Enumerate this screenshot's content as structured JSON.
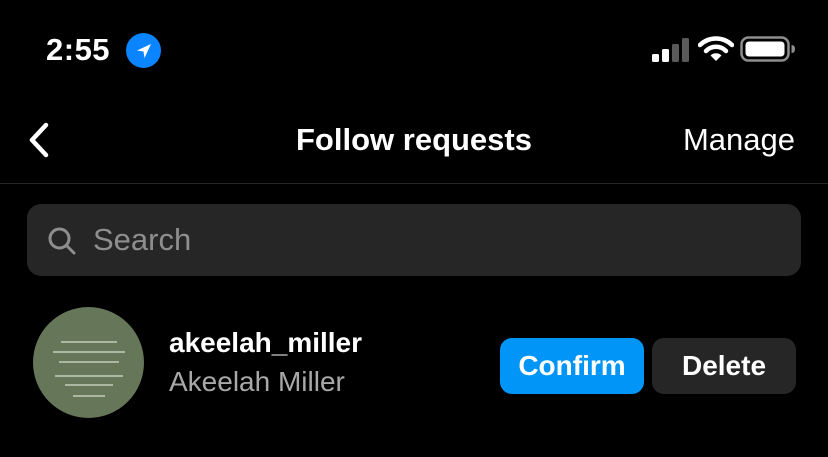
{
  "status_bar": {
    "time": "2:55",
    "location_icon": "location-arrow-icon",
    "signal_icon": "cellular-signal-icon",
    "wifi_icon": "wifi-icon",
    "battery_icon": "battery-icon",
    "location_color": "#0a84ff"
  },
  "header": {
    "back_icon": "chevron-left-icon",
    "title": "Follow requests",
    "manage_label": "Manage"
  },
  "search": {
    "icon": "search-icon",
    "placeholder": "Search",
    "value": ""
  },
  "requests": [
    {
      "username": "akeelah_miller",
      "full_name": "Akeelah Miller",
      "confirm_label": "Confirm",
      "delete_label": "Delete"
    }
  ],
  "colors": {
    "background": "#000000",
    "primary_button": "#0095f6",
    "secondary_button": "#262626",
    "secondary_text": "#a8a8a8"
  }
}
